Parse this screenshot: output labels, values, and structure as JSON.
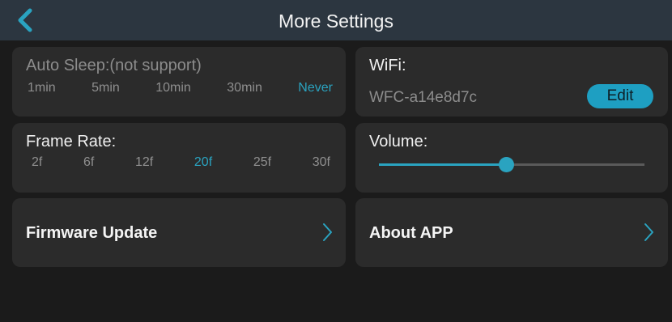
{
  "header": {
    "title": "More Settings",
    "back_icon": "chevron-left-icon",
    "background": "#2c3640",
    "accent": "#2aa3c0"
  },
  "auto_sleep": {
    "label": "Auto Sleep:(not support)",
    "options": [
      "1min",
      "5min",
      "10min",
      "30min",
      "Never"
    ],
    "selected": "Never"
  },
  "frame_rate": {
    "label": "Frame Rate:",
    "options": [
      "2f",
      "6f",
      "12f",
      "20f",
      "25f",
      "30f"
    ],
    "selected": "20f"
  },
  "wifi": {
    "label": "WiFi:",
    "ssid": "WFC-a14e8d7c",
    "edit_label": "Edit"
  },
  "volume": {
    "label": "Volume:",
    "level": 0.48
  },
  "firmware": {
    "label": "Firmware Update",
    "icon": "chevron-right-icon"
  },
  "about": {
    "label": "About APP",
    "icon": "chevron-right-icon"
  }
}
